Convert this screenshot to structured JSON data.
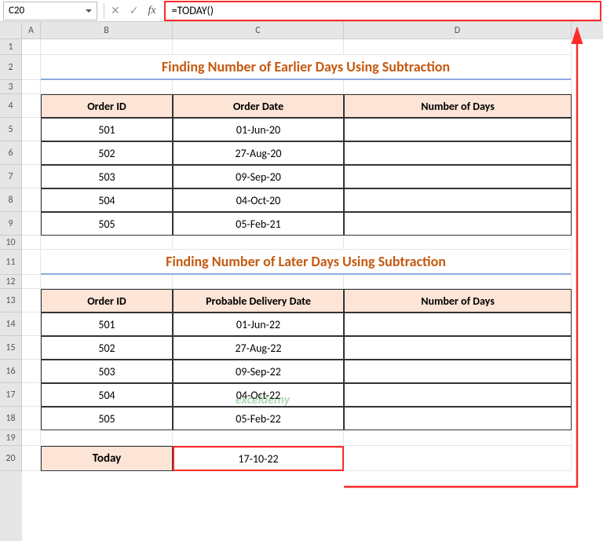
{
  "formula_bar": {
    "name_box": "C20",
    "formula": "=TODAY()"
  },
  "columns": [
    "A",
    "B",
    "C",
    "D"
  ],
  "rows": [
    "1",
    "2",
    "3",
    "4",
    "5",
    "6",
    "7",
    "8",
    "9",
    "10",
    "11",
    "12",
    "13",
    "14",
    "15",
    "16",
    "17",
    "18",
    "19",
    "20"
  ],
  "title1": "Finding Number of Earlier Days Using Subtraction",
  "title2": "Finding Number of Later Days Using Subtraction",
  "table1": {
    "headers": {
      "b": "Order ID",
      "c": "Order Date",
      "d": "Number of Days"
    },
    "rows": [
      {
        "id": "501",
        "date": "01-Jun-20",
        "days": ""
      },
      {
        "id": "502",
        "date": "27-Aug-20",
        "days": ""
      },
      {
        "id": "503",
        "date": "09-Sep-20",
        "days": ""
      },
      {
        "id": "504",
        "date": "04-Oct-20",
        "days": ""
      },
      {
        "id": "505",
        "date": "05-Feb-21",
        "days": ""
      }
    ]
  },
  "table2": {
    "headers": {
      "b": "Order ID",
      "c": "Probable Delivery Date",
      "d": "Number of Days"
    },
    "rows": [
      {
        "id": "501",
        "date": "01-Jun-22",
        "days": ""
      },
      {
        "id": "502",
        "date": "27-Aug-22",
        "days": ""
      },
      {
        "id": "503",
        "date": "09-Sep-22",
        "days": ""
      },
      {
        "id": "504",
        "date": "04-Oct-22",
        "days": ""
      },
      {
        "id": "505",
        "date": "05-Feb-22",
        "days": ""
      }
    ]
  },
  "today": {
    "label": "Today",
    "value": "17-10-22"
  },
  "watermark": "exceldemy"
}
